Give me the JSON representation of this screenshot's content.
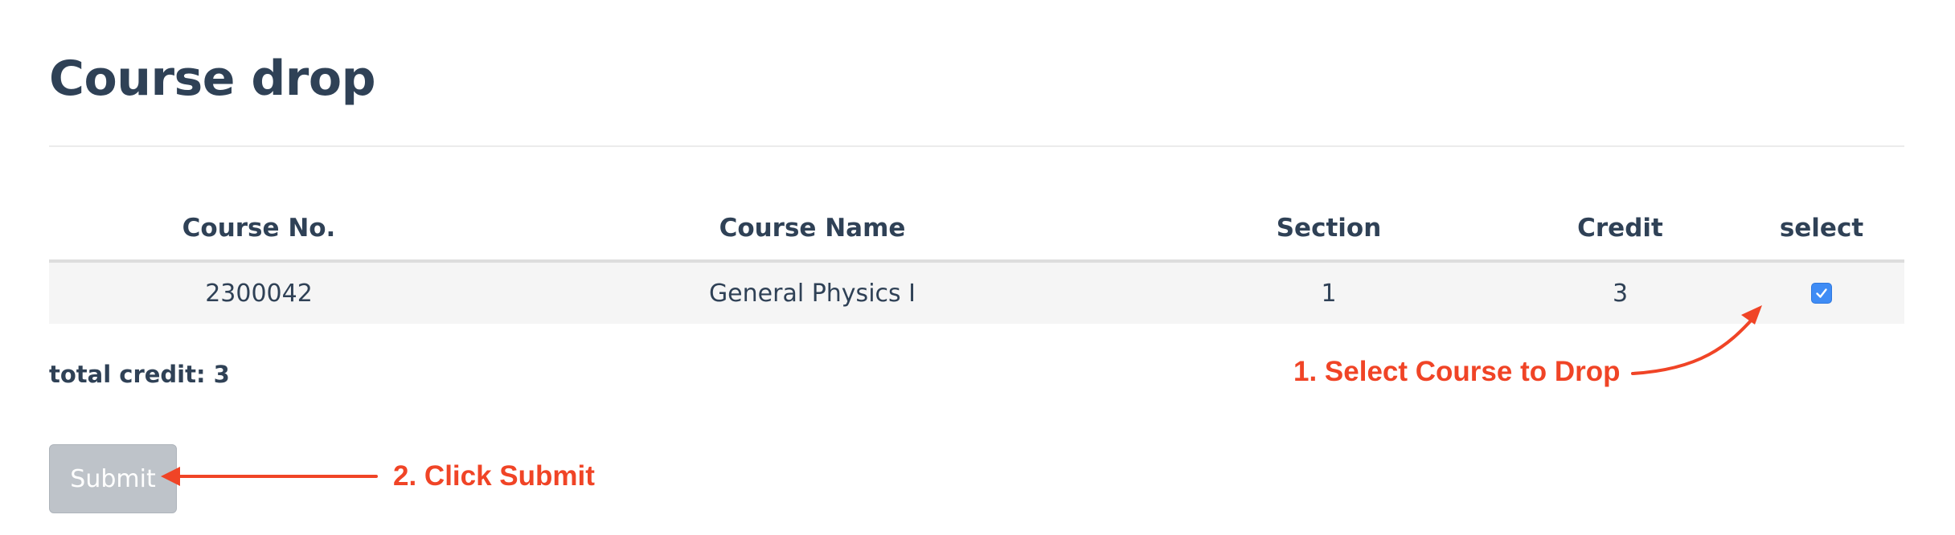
{
  "page": {
    "title": "Course drop"
  },
  "table": {
    "columns": [
      "Course No.",
      "Course Name",
      "Section",
      "Credit",
      "select"
    ],
    "rows": [
      {
        "course_no": "2300042",
        "course_name": "General Physics I",
        "section": "1",
        "credit": "3",
        "selected": true
      }
    ]
  },
  "summary": {
    "total_credit_label": "total credit: 3"
  },
  "actions": {
    "submit_label": "Submit"
  },
  "annotations": {
    "step_1": "1. Select Course to Drop",
    "step_2": "2. Click Submit",
    "color": "#f04426"
  },
  "colors": {
    "text": "#2f4156",
    "row_background": "#f5f5f5",
    "checkbox_accent": "#3f8cf5",
    "submit_disabled": "#bec3c9"
  }
}
